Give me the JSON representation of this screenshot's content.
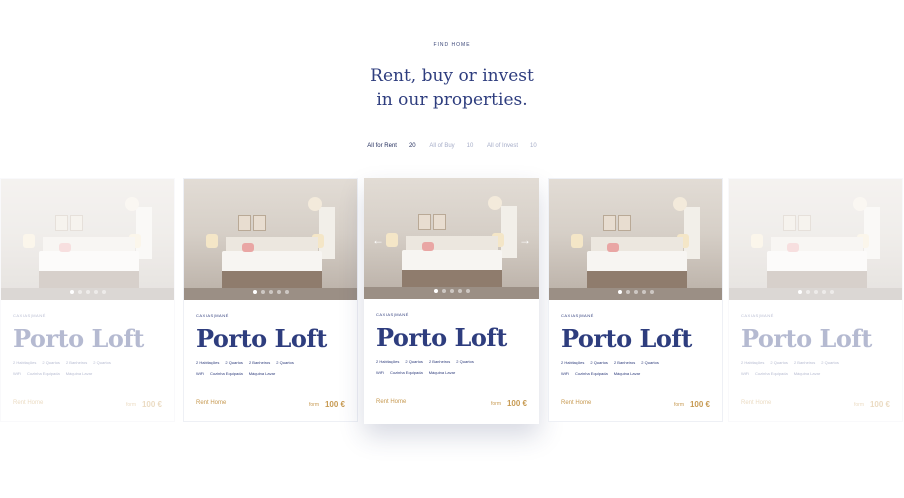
{
  "section": {
    "eyebrow": "FIND HOME",
    "headline_line1": "Rent, buy or invest",
    "headline_line2": "in our properties."
  },
  "tabs": [
    {
      "label": "All for Rent",
      "count": "20"
    },
    {
      "label": "All of Buy",
      "count": "10"
    },
    {
      "label": "All of Invest",
      "count": "10"
    }
  ],
  "colors": {
    "primary_navy": "#2e3d7e",
    "accent_gold": "#c79a52",
    "tab_inactive": "#a6adc8"
  },
  "cards": [
    {
      "location": "CAXIAS|MANÉ",
      "title": "Porto Loft",
      "spec1": "2 Habitações",
      "spec2": "2 Quartos",
      "spec3": "2 Banheiros",
      "spec4": "2 Quartos",
      "feat1": "WiFi",
      "feat2": "Cozinha Equipada",
      "feat3": "Máquina Lavar",
      "cta": "Rent Home",
      "from_label": "form",
      "price": "100 €"
    },
    {
      "location": "CAXIAS|MANÉ",
      "title": "Porto Loft",
      "spec1": "2 Habitações",
      "spec2": "2 Quartos",
      "spec3": "2 Banheiros",
      "spec4": "2 Quartos",
      "feat1": "WiFi",
      "feat2": "Cozinha Equipada",
      "feat3": "Máquina Lavar",
      "cta": "Rent Home",
      "from_label": "form",
      "price": "100 €"
    },
    {
      "location": "CAXIAS|MANÉ",
      "title": "Porto Loft",
      "spec1": "2 Habitações",
      "spec2": "2 Quartos",
      "spec3": "2 Banheiros",
      "spec4": "2 Quartos",
      "feat1": "WiFi",
      "feat2": "Cozinha Equipada",
      "feat3": "Máquina Lavar",
      "cta": "Rent Home",
      "from_label": "form",
      "price": "100 €"
    },
    {
      "location": "CAXIAS|MANÉ",
      "title": "Porto Loft",
      "spec1": "2 Habitações",
      "spec2": "2 Quartos",
      "spec3": "2 Banheiros",
      "spec4": "2 Quartos",
      "feat1": "WiFi",
      "feat2": "Cozinha Equipada",
      "feat3": "Máquina Lavar",
      "cta": "Rent Home",
      "from_label": "form",
      "price": "100 €"
    },
    {
      "location": "CAXIAS|MANÉ",
      "title": "Porto Loft",
      "spec1": "2 Habitações",
      "spec2": "2 Quartos",
      "spec3": "2 Banheiros",
      "spec4": "2 Quartos",
      "feat1": "WiFi",
      "feat2": "Cozinha Equipada",
      "feat3": "Máquina Lavar",
      "cta": "Rent Home",
      "from_label": "form",
      "price": "100 €"
    }
  ],
  "arrows": {
    "left": "←",
    "right": "→"
  }
}
